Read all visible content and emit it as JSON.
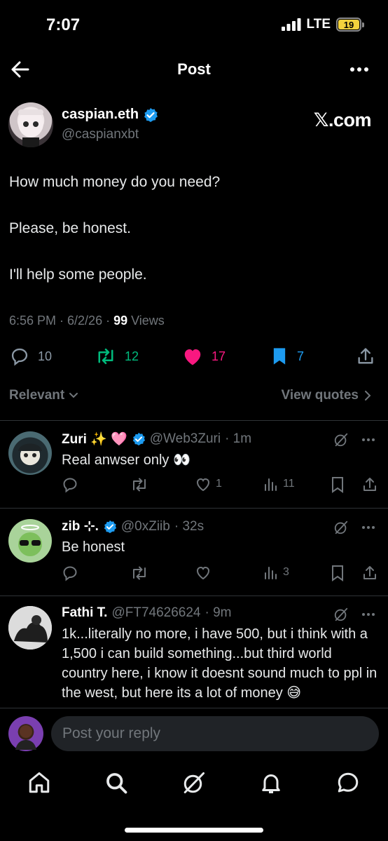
{
  "status": {
    "time": "7:07",
    "network": "LTE",
    "battery": "19"
  },
  "header": {
    "title": "Post"
  },
  "post": {
    "author_name": "caspian.eth",
    "author_handle": "@caspianxbt",
    "source": "𝕏.com",
    "lines": [
      "How much money do you need?",
      "Please, be honest.",
      "I'll help some people."
    ],
    "time": "6:56 PM · 6/2/26 · ",
    "views_count": "99",
    "views_label": " Views",
    "stats": {
      "replies": "10",
      "reposts": "12",
      "likes": "17",
      "bookmarks": "7"
    },
    "colors": {
      "repost": "#00ba7c",
      "like": "#f91880",
      "bookmark": "#1d9bf0",
      "verified": "#1d9bf0"
    }
  },
  "filter": {
    "sort_label": "Relevant",
    "quotes_label": "View quotes"
  },
  "replies": [
    {
      "name": "Zuri ✨ 🩷",
      "handle": "@Web3Zuri",
      "time": "· 1m",
      "text": "Real anwser only 👀",
      "likes": "1",
      "views": "11"
    },
    {
      "name": "zib ⊹.",
      "handle": "@0xZiib",
      "time": "· 32s",
      "text": "Be honest",
      "likes": "",
      "views": "3"
    },
    {
      "name": "Fathi T.",
      "handle": "@FT74626624",
      "time": "· 9m",
      "text": "1k...literally no more, i have 500, but i think with a 1,500 i can build something...but third world country here, i know it doesnt sound much to ppl in the west, but here its a lot of money 😅"
    }
  ],
  "composer": {
    "placeholder": "Post your reply"
  },
  "tabs": [
    "home-icon",
    "search-icon",
    "grok-icon",
    "notifications-icon",
    "messages-icon"
  ]
}
